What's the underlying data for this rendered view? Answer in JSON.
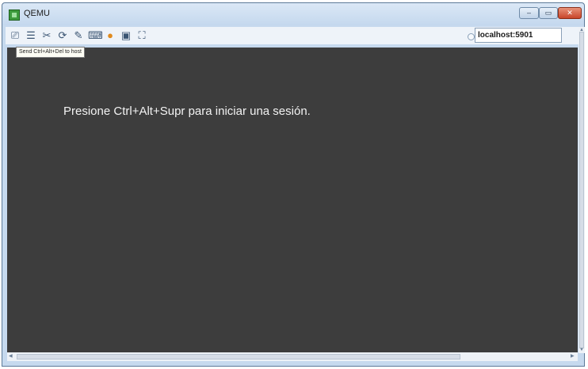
{
  "window": {
    "title": "QEMU",
    "controls": {
      "minimize": "–",
      "maximize": "▭",
      "close": "✕"
    }
  },
  "toolbar": {
    "tools": [
      {
        "name": "send-ctrl-alt-del-icon",
        "glyph": "⎚"
      },
      {
        "name": "menu-icon",
        "glyph": "☰"
      },
      {
        "name": "scissors-icon",
        "glyph": "✂"
      },
      {
        "name": "refresh-icon",
        "glyph": "⟳"
      },
      {
        "name": "paint-icon",
        "glyph": "✎"
      },
      {
        "name": "keyboard-icon",
        "glyph": "⌨"
      },
      {
        "name": "info-icon",
        "glyph": "●"
      },
      {
        "name": "screenshot-icon",
        "glyph": "▣"
      },
      {
        "name": "fullscreen-icon",
        "glyph": "⛶"
      }
    ],
    "host": "localhost:5901"
  },
  "tooltip": "Send Ctrl+Alt+Del to host",
  "screen": {
    "message": "Presione Ctrl+Alt+Supr para iniciar una sesión."
  },
  "colors": {
    "screen_bg": "#3d3d3d",
    "frame": "#c6d9ee",
    "close": "#c8452a"
  }
}
